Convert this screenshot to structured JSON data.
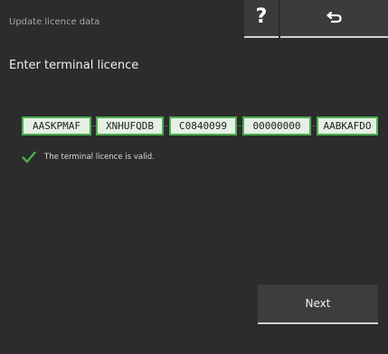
{
  "header": {
    "title": "Update licence data",
    "help_icon": "question-mark-icon",
    "back_icon": "return-arrow-icon"
  },
  "main": {
    "section_title": "Enter terminal licence",
    "licence_fields": [
      {
        "value": "AASKPMAF"
      },
      {
        "value": "XNHUFQDB"
      },
      {
        "value": "C0840099"
      },
      {
        "value": "00000000"
      },
      {
        "value": "AABKAFDO"
      }
    ],
    "status": {
      "icon": "checkmark-icon",
      "text": "The terminal licence is valid.",
      "color": "#4caf50"
    },
    "next_label": "Next"
  },
  "colors": {
    "background": "#2c2c2c",
    "field_border": "#4caf50",
    "field_fill": "#e6f0e4",
    "button": "#3d3d3d"
  }
}
